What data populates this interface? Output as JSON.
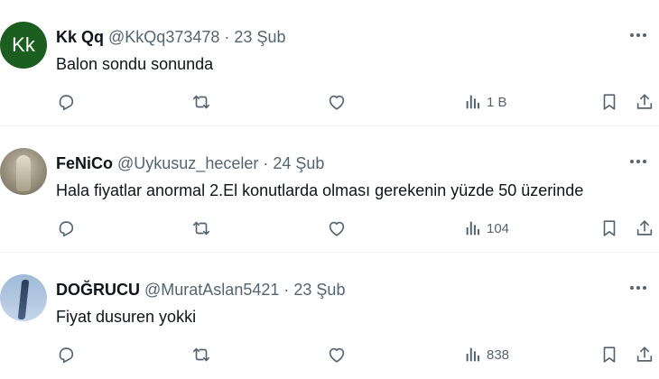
{
  "tweets": [
    {
      "name": "Kk Qq",
      "handle": "@KkQq373478",
      "separator": "·",
      "date": "23 Şub",
      "text": "Balon sondu sonunda",
      "views": "1 B",
      "avatar": {
        "type": "initials",
        "initials": "Kk",
        "color": "#1b5e20"
      }
    },
    {
      "name": "FeNiCo",
      "handle": "@Uykusuz_heceler",
      "separator": "·",
      "date": "24 Şub",
      "text": "Hala fiyatlar anormal 2.El konutlarda olması gerekenin yüzde 50 üzerinde",
      "views": "104",
      "avatar": {
        "type": "photo"
      }
    },
    {
      "name": "DOĞRUCU",
      "handle": "@MuratAslan5421",
      "separator": "·",
      "date": "23 Şub",
      "text": "Fiyat dusuren yokki",
      "views": "838",
      "avatar": {
        "type": "photo"
      }
    }
  ],
  "icons": {
    "reply": "reply-icon",
    "retweet": "retweet-icon",
    "like": "heart-icon",
    "views": "views-icon",
    "bookmark": "bookmark-icon",
    "share": "share-icon",
    "more": "more-icon"
  },
  "colors": {
    "text": "#0f1419",
    "secondary": "#536471",
    "divider": "#eff3f4"
  }
}
